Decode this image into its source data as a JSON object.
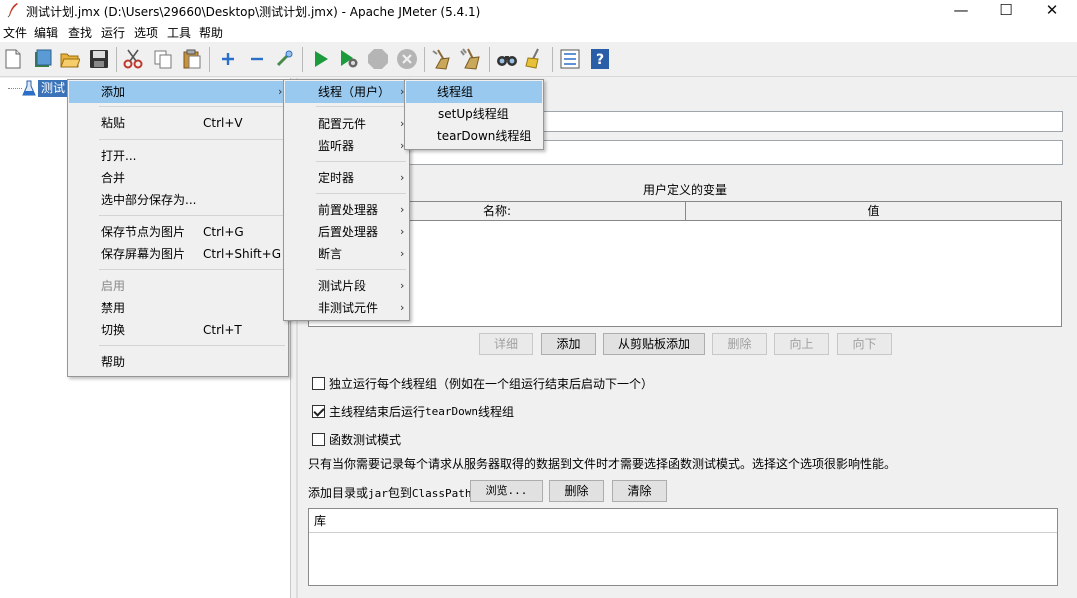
{
  "window": {
    "title": "测试计划.jmx (D:\\Users\\29660\\Desktop\\测试计划.jmx) - Apache JMeter (5.4.1)",
    "minimize": "—",
    "maximize": "☐",
    "close": "✕"
  },
  "menubar": [
    "文件",
    "编辑",
    "查找",
    "运行",
    "选项",
    "工具",
    "帮助"
  ],
  "toolbar_icons": [
    "new-icon",
    "templates-icon",
    "open-icon",
    "save-icon",
    "cut-icon",
    "copy-icon",
    "paste-icon",
    "expand-icon",
    "collapse-icon",
    "toggle-icon",
    "start-icon",
    "start-no-pause-icon",
    "stop-icon",
    "shutdown-icon",
    "clear-icon",
    "clear-all-icon",
    "search-icon",
    "reset-search-icon",
    "function-helper-icon",
    "help-icon"
  ],
  "tree": {
    "root_label": "测试"
  },
  "context_menu": {
    "items": [
      {
        "label": "添加",
        "submenu": true,
        "highlight": true
      },
      {
        "label": "粘贴",
        "shortcut": "Ctrl+V"
      },
      {
        "label": "打开..."
      },
      {
        "label": "合并"
      },
      {
        "label": "选中部分保存为..."
      },
      {
        "label": "保存节点为图片",
        "shortcut": "Ctrl+G"
      },
      {
        "label": "保存屏幕为图片",
        "shortcut": "Ctrl+Shift+G"
      },
      {
        "label": "启用",
        "disabled": true
      },
      {
        "label": "禁用"
      },
      {
        "label": "切换",
        "shortcut": "Ctrl+T"
      },
      {
        "label": "帮助"
      }
    ]
  },
  "add_menu": {
    "items": [
      {
        "label": "线程（用户）",
        "highlight": true
      },
      {
        "label": "配置元件"
      },
      {
        "label": "监听器"
      },
      {
        "label": "定时器"
      },
      {
        "label": "前置处理器"
      },
      {
        "label": "后置处理器"
      },
      {
        "label": "断言"
      },
      {
        "label": "测试片段"
      },
      {
        "label": "非测试元件"
      }
    ]
  },
  "threads_menu": {
    "items": [
      {
        "label": "线程组",
        "highlight": true
      },
      {
        "label": "setUp线程组"
      },
      {
        "label": "tearDown线程组"
      }
    ]
  },
  "variables": {
    "title": "用户定义的变量",
    "col_name": "名称:",
    "col_value": "值"
  },
  "table_buttons": {
    "detail": "详细",
    "add": "添加",
    "add_clipboard": "从剪贴板添加",
    "delete": "删除",
    "up": "向上",
    "down": "向下"
  },
  "options": {
    "serialize": {
      "label": "独立运行每个线程组（例如在一个组运行结束后启动下一个）",
      "checked": false
    },
    "teardown_prefix": "主线程结束后运行 ",
    "teardown_mono": "tearDown",
    "teardown_suffix": "线程组",
    "teardown_checked": true,
    "functional": {
      "label": "函数测试模式",
      "checked": false
    }
  },
  "functional_note": "只有当你需要记录每个请求从服务器取得的数据到文件时才需要选择函数测试模式。选择这个选项很影响性能。",
  "classpath": {
    "label_prefix": "添加目录或",
    "label_mono": "jar",
    "label_mid": "包到",
    "label_mono2": "ClassPath",
    "browse": "浏览...",
    "delete": "删除",
    "clear": "清除"
  },
  "library": {
    "header": "库"
  }
}
